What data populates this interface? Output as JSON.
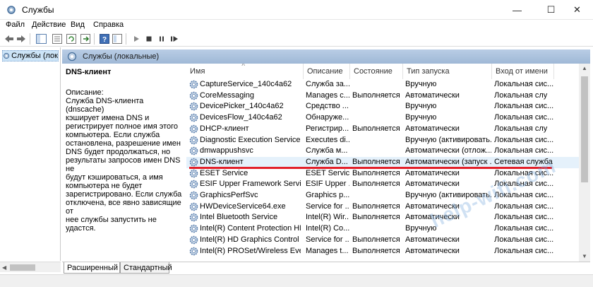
{
  "window": {
    "title": "Службы",
    "min_icon": "minimize-icon",
    "max_icon": "maximize-icon",
    "close_icon": "close-icon"
  },
  "menu": [
    "Файл",
    "Действие",
    "Вид",
    "Справка"
  ],
  "tree": {
    "selected_label": "Службы (лок"
  },
  "header": {
    "label": "Службы (локальные)"
  },
  "description": {
    "service_name": "DNS-клиент",
    "label": "Описание:",
    "text": "Служба DNS-клиента (dnscache)\nкэширует имена DNS и\nрегистрирует полное имя этого\nкомпьютера. Если служба\nостановлена, разрешение имен\nDNS будет продолжаться, но\nрезультаты запросов имен DNS не\nбудут кэшироваться, а имя\nкомпьютера не будет\nзарегистрировано. Если служба\nотключена, все явно зависящие от\nнее службы запустить не удастся."
  },
  "columns": [
    "Имя",
    "Описание",
    "Состояние",
    "Тип запуска",
    "Вход от имени"
  ],
  "rows": [
    {
      "name": "CaptureService_140c4a62",
      "desc": "Служба за...",
      "state": "",
      "start": "Вручную",
      "logon": "Локальная сис..."
    },
    {
      "name": "CoreMessaging",
      "desc": "Manages c...",
      "state": "Выполняется",
      "start": "Автоматически",
      "logon": "Локальная слу"
    },
    {
      "name": "DevicePicker_140c4a62",
      "desc": "Средство ...",
      "state": "",
      "start": "Вручную",
      "logon": "Локальная сис..."
    },
    {
      "name": "DevicesFlow_140c4a62",
      "desc": "Обнаруже...",
      "state": "",
      "start": "Вручную",
      "logon": "Локальная сис..."
    },
    {
      "name": "DHCP-клиент",
      "desc": "Регистрир...",
      "state": "Выполняется",
      "start": "Автоматически",
      "logon": "Локальная слу"
    },
    {
      "name": "Diagnostic Execution Service",
      "desc": "Executes di...",
      "state": "",
      "start": "Вручную (активировать...",
      "logon": "Локальная сис..."
    },
    {
      "name": "dmwappushsvc",
      "desc": "Служба м...",
      "state": "",
      "start": "Автоматически (отлож...",
      "logon": "Локальная сис..."
    },
    {
      "name": "DNS-клиент",
      "desc": "Служба D...",
      "state": "Выполняется",
      "start": "Автоматически (запуск ...",
      "logon": "Сетевая служба",
      "selected": true
    },
    {
      "name": "ESET Service",
      "desc": "ESET Service",
      "state": "Выполняется",
      "start": "Автоматически",
      "logon": "Локальная сис..."
    },
    {
      "name": "ESIF Upper Framework Service",
      "desc": "ESIF Upper ...",
      "state": "Выполняется",
      "start": "Автоматически",
      "logon": "Локальная сис..."
    },
    {
      "name": "GraphicsPerfSvc",
      "desc": "Graphics p...",
      "state": "",
      "start": "Вручную (активировать...",
      "logon": "Локальная сис..."
    },
    {
      "name": "HWDeviceService64.exe",
      "desc": "Service for ...",
      "state": "Выполняется",
      "start": "Автоматически",
      "logon": "Локальная сис..."
    },
    {
      "name": "Intel Bluetooth Service",
      "desc": "Intel(R) Wir...",
      "state": "Выполняется",
      "start": "Автоматически",
      "logon": "Локальная сис..."
    },
    {
      "name": "Intel(R) Content Protection HE...",
      "desc": "Intel(R) Co...",
      "state": "",
      "start": "Вручную",
      "logon": "Локальная сис..."
    },
    {
      "name": "Intel(R) HD Graphics Control P...",
      "desc": "Service for ...",
      "state": "Выполняется",
      "start": "Автоматически",
      "logon": "Локальная сис..."
    },
    {
      "name": "Intel(R) PROSet/Wireless Event ...",
      "desc": "Manages t...",
      "state": "Выполняется",
      "start": "Автоматически",
      "logon": "Локальная сис..."
    }
  ],
  "tabs": [
    "Расширенный",
    "Стандартный"
  ],
  "watermark": "help-wifi.com",
  "colors": {
    "selection": "#e5f1fb",
    "header_blue": "#b0c6e1",
    "underline_red": "#e2202a"
  }
}
